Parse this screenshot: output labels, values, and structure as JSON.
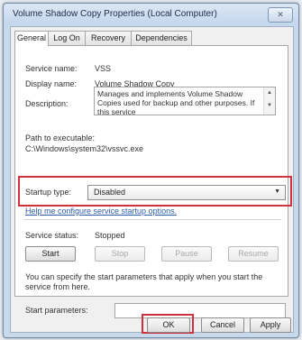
{
  "window": {
    "title": "Volume Shadow Copy Properties (Local Computer)",
    "close_glyph": "✕"
  },
  "tabs": [
    {
      "label": "General",
      "active": true
    },
    {
      "label": "Log On",
      "active": false
    },
    {
      "label": "Recovery",
      "active": false
    },
    {
      "label": "Dependencies",
      "active": false
    }
  ],
  "general": {
    "service_name_label": "Service name:",
    "service_name_value": "VSS",
    "display_name_label": "Display name:",
    "display_name_value": "Volume Shadow Copy",
    "description_label": "Description:",
    "description_value": "Manages and implements Volume Shadow Copies used for backup and other purposes. If this service",
    "path_label": "Path to executable:",
    "path_value": "C:\\Windows\\system32\\vssvc.exe",
    "startup_type_label": "Startup type:",
    "startup_type_value": "Disabled",
    "help_link": "Help me configure service startup options.",
    "service_status_label": "Service status:",
    "service_status_value": "Stopped",
    "start_button": "Start",
    "stop_button": "Stop",
    "pause_button": "Pause",
    "resume_button": "Resume",
    "start_params_hint": "You can specify the start parameters that apply when you start the service from here.",
    "start_params_label": "Start parameters:",
    "start_params_value": ""
  },
  "footer": {
    "ok_button": "OK",
    "cancel_button": "Cancel",
    "apply_button": "Apply"
  },
  "colors": {
    "highlight": "#d0313a",
    "link": "#2a5aa8"
  }
}
